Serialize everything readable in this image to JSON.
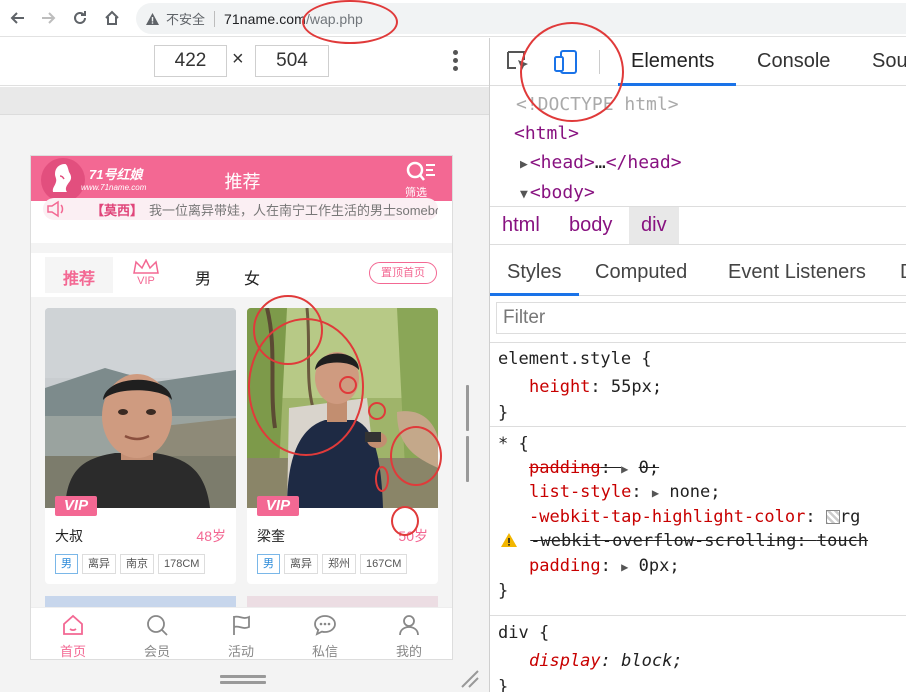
{
  "browser": {
    "security_label": "不安全",
    "url_host": "71name.com",
    "url_path": "/wap.php"
  },
  "device_toolbar": {
    "width": "422",
    "height": "504",
    "separator": "×"
  },
  "app": {
    "logo_title": "71号红娘",
    "logo_sub": "www.71name.com",
    "header_title": "推荐",
    "filter_label": "筛选",
    "notice_name": "【莫西】",
    "notice_text": "我一位离异带娃，人在南宁工作生活的男士somebody…",
    "tabs": {
      "recommend": "推荐",
      "vip": "VIP",
      "male": "男",
      "female": "女",
      "top_button": "置顶首页"
    },
    "cards": [
      {
        "badge": "VIP",
        "name": "大叔",
        "age": "48岁",
        "tags": [
          "男",
          "离异",
          "南京",
          "178CM"
        ]
      },
      {
        "badge": "VIP",
        "name": "梁奎",
        "age": "50岁",
        "tags": [
          "男",
          "离异",
          "郑州",
          "167CM"
        ]
      }
    ],
    "bottom_nav": [
      "首页",
      "会员",
      "活动",
      "私信",
      "我的"
    ]
  },
  "devtools": {
    "tabs": [
      "Elements",
      "Console",
      "Sou"
    ],
    "dom": {
      "doctype": "<!DOCTYPE html>",
      "html_open": "<html>",
      "head_open": "<head>",
      "head_ellipsis": "…",
      "head_close": "</head>",
      "body_open": "<body>"
    },
    "breadcrumbs": [
      "html",
      "body",
      "div"
    ],
    "sub_tabs": [
      "Styles",
      "Computed",
      "Event Listeners",
      "D"
    ],
    "filter_placeholder": "Filter",
    "styles": {
      "element_style_selector": "element.style {",
      "element_height_prop": "height",
      "element_height_val": "55px;",
      "star_selector": "* {",
      "padding_prop": "padding",
      "padding_val_struck": "0;",
      "list_style_prop": "list-style",
      "list_style_val": "none;",
      "tap_prop": "-webkit-tap-highlight-color",
      "tap_val": "rg",
      "overflow_prop": "-webkit-overflow-scrolling",
      "overflow_val": "touch",
      "padding2_prop": "padding",
      "padding2_val": "0px;",
      "div_selector": "div {",
      "display_prop": "display",
      "display_val": "block;",
      "close_brace": "}"
    },
    "accent_color": "#1a73e8"
  },
  "colors": {
    "brand_pink": "#f36893",
    "annotation_red": "#e03a3a"
  }
}
